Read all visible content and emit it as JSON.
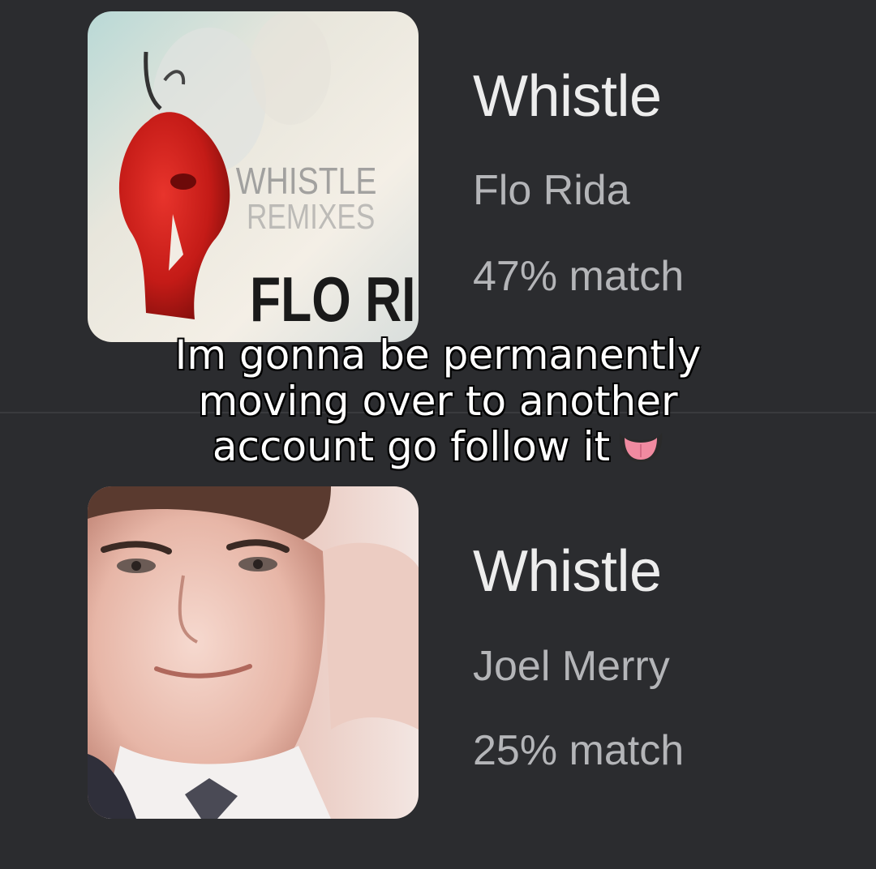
{
  "results": [
    {
      "title": "Whistle",
      "artist": "Flo Rida",
      "match": "47% match",
      "cover": {
        "line1": "WHISTLE",
        "line2": "REMIXES",
        "line3": "FLO RIDA",
        "accent": "#c81e1a"
      }
    },
    {
      "title": "Whistle",
      "artist": "Joel Merry",
      "match": "25% match"
    }
  ],
  "overlay": {
    "line1": "Im gonna be permanently",
    "line2": "moving over to another",
    "line3": "account go follow it",
    "emoji_icon": "tongue-face-emoji"
  },
  "colors": {
    "background": "#2b2c2f",
    "title": "#ededed",
    "secondary": "#b4b5b8"
  }
}
